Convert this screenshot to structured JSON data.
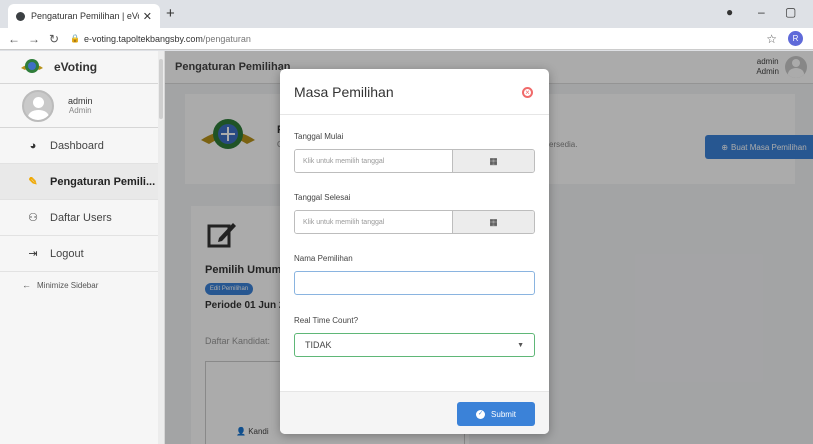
{
  "browser": {
    "tab_title": "Pengaturan Pemilihan | eVoting",
    "tab_close": "✕",
    "new_tab": "+",
    "url_host": "e-voting.tapoltekbangsby.com",
    "url_path": "/pengaturan",
    "profile_initial": "R",
    "controls": {
      "minimize": "–",
      "maximize": "▢",
      "close": "✕"
    }
  },
  "sidebar": {
    "brand": "eVoting",
    "user_name": "admin",
    "user_role": "Admin",
    "items": [
      {
        "label": "Dashboard",
        "icon": "dashboard-icon",
        "glyph": "⌚"
      },
      {
        "label": "Pengaturan Pemili...",
        "icon": "wrench-icon",
        "glyph": "🔧",
        "active": true
      },
      {
        "label": "Daftar Users",
        "icon": "users-icon",
        "glyph": "👥"
      },
      {
        "label": "Logout",
        "icon": "logout-icon",
        "glyph": "⇥"
      }
    ],
    "minimize_label": "Minimize Sidebar"
  },
  "topbar": {
    "title": "Pengaturan Pemilihan",
    "user_name": "admin",
    "user_role": "Admin"
  },
  "background": {
    "hero_title": "P",
    "hero_sub": "G",
    "hero_sub_right": "ersedia.",
    "create_button": "Buat Masa Pemilihan",
    "card_title": "Pemilih Umum",
    "edit_button": "Edit Pemilihan",
    "periode": "Periode 01 Jun 2",
    "daftar_kandidat": "Daftar Kandidat:",
    "kandidat_label": "Kandi"
  },
  "modal": {
    "title": "Masa Pemilihan",
    "close_glyph": "×",
    "start_label": "Tanggal Mulai",
    "start_placeholder": "Klik untuk memilih tanggal",
    "end_label": "Tanggal Selesai",
    "end_placeholder": "Klik untuk memilih tanggal",
    "name_label": "Nama Pemilihan",
    "name_value": "",
    "realtime_label": "Real Time Count?",
    "realtime_value": "TIDAK",
    "submit_label": "Submit"
  },
  "colors": {
    "primary": "#3b82d8",
    "close_red": "#f06a6a",
    "select_border": "#5fb777",
    "sidebar_active_icon": "#f0a800"
  }
}
